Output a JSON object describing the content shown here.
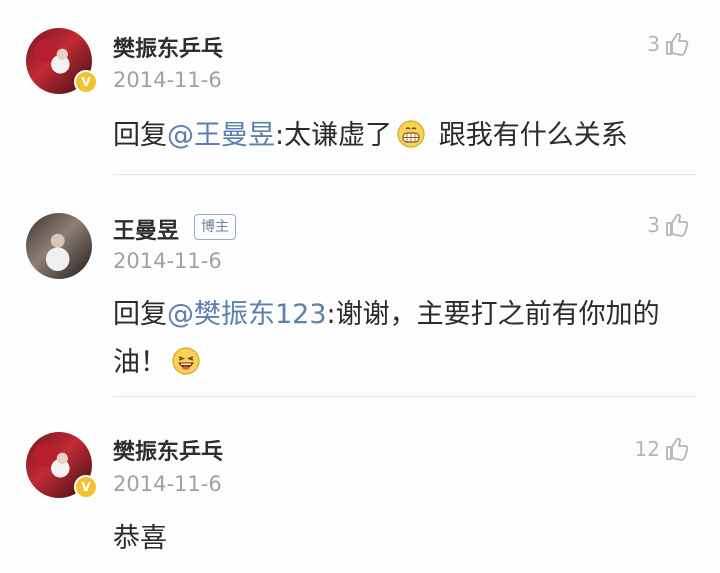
{
  "comments": [
    {
      "author": "樊振东乒乓",
      "date": "2014-11-6",
      "likes": "3",
      "reply_prefix": "回复",
      "mention": "@王曼昱",
      "text_before_emoji": ":太谦虚了",
      "emoji": "grin-icon",
      "text_after_emoji": " 跟我有什么关系",
      "verified": true
    },
    {
      "author": "王曼昱",
      "badge": "博主",
      "date": "2014-11-6",
      "likes": "3",
      "reply_prefix": "回复",
      "mention": "@樊振东123",
      "text_before_emoji": ":谢谢，主要打之前有你加的油！",
      "emoji": "laugh-icon"
    },
    {
      "author": "樊振东乒乓",
      "date": "2014-11-6",
      "likes": "12",
      "text": "恭喜",
      "verified": true
    }
  ],
  "colors": {
    "mention": "#5c7fb0",
    "verified_badge": "#f1c231",
    "meta_gray": "#a1a1a1"
  }
}
